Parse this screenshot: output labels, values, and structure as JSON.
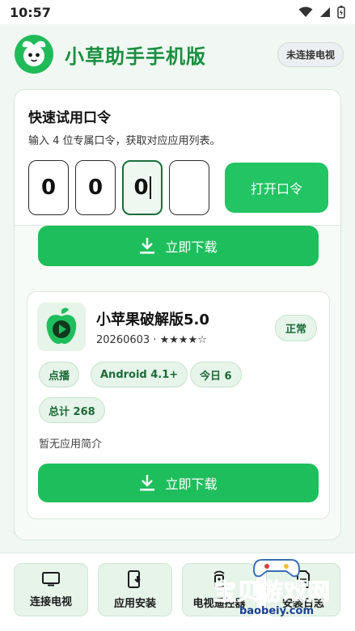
{
  "status_bar": {
    "time": "10:57"
  },
  "header": {
    "title": "小草助手手机版",
    "connection_badge": "未连接电视"
  },
  "quick_code": {
    "title": "快速试用口令",
    "description": "输入 4 位专属口令，获取对应应用列表。",
    "digits": [
      "0",
      "0",
      "0",
      ""
    ],
    "open_button": "打开口令"
  },
  "download_label": "立即下载",
  "app": {
    "name": "小苹果破解版5.0",
    "version_date": "20260603",
    "rating_text": "★★★★☆",
    "status": "正常",
    "tags": [
      "点播",
      "Android 4.1+",
      "今日 6",
      "总计 268"
    ],
    "description": "暂无应用简介"
  },
  "bottom_nav": [
    "连接电视",
    "应用安装",
    "电视遥控器",
    "安装日志"
  ],
  "watermark": {
    "text": "宝贝游戏网",
    "url": "baobeiy.com"
  },
  "colors": {
    "brand_green": "#1fbe5c",
    "title_green": "#1a8f41",
    "chip_bg": "#e6f4e9"
  }
}
